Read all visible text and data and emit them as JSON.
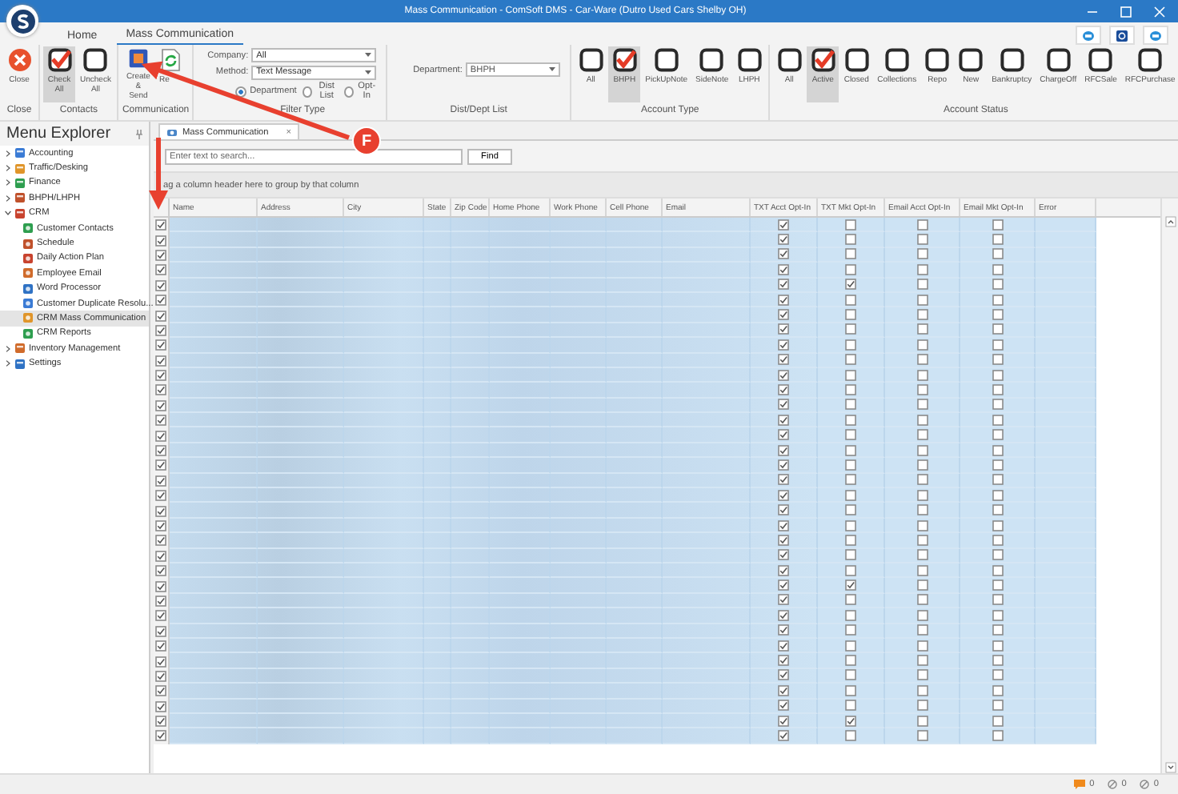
{
  "window": {
    "title": "Mass Communication - ComSoft DMS - Car-Ware (Dutro Used Cars Shelby OH)"
  },
  "ribbon_tabs": [
    {
      "label": "Home",
      "selected": false
    },
    {
      "label": "Mass Communication",
      "selected": true
    }
  ],
  "ribbon_groups": [
    {
      "label": "Close",
      "kind": "buttons",
      "items": [
        {
          "kind": "close",
          "label": "Close"
        }
      ]
    },
    {
      "label": "Contacts",
      "kind": "buttons",
      "items": [
        {
          "kind": "toggle",
          "label": "Check All",
          "checked": true
        },
        {
          "kind": "toggle",
          "label": "Uncheck All",
          "checked": false
        }
      ]
    },
    {
      "label": "Communication",
      "kind": "buttons",
      "items": [
        {
          "kind": "send",
          "label": "Create & Send"
        },
        {
          "kind": "refresh",
          "label": "Re"
        }
      ]
    },
    {
      "label": "Filter Type",
      "kind": "filter",
      "fields": [
        {
          "label": "Company:",
          "value": "All"
        },
        {
          "label": "Method:",
          "value": "Text Message"
        }
      ],
      "radios": [
        {
          "label": "Department",
          "selected": true
        },
        {
          "label": "Dist List",
          "selected": false
        },
        {
          "label": "Opt-In",
          "selected": false
        }
      ]
    },
    {
      "label": "Dist/Dept List",
      "kind": "department",
      "field": {
        "label": "Department:",
        "value": "BHPH"
      }
    },
    {
      "label": "Account Type",
      "kind": "buttons",
      "items": [
        {
          "kind": "toggle",
          "label": "All",
          "checked": false
        },
        {
          "kind": "toggle",
          "label": "BHPH",
          "checked": true
        },
        {
          "kind": "toggle",
          "label": "PickUpNote",
          "checked": false
        },
        {
          "kind": "toggle",
          "label": "SideNote",
          "checked": false
        },
        {
          "kind": "toggle",
          "label": "LHPH",
          "checked": false
        }
      ]
    },
    {
      "label": "Account Status",
      "kind": "buttons",
      "items": [
        {
          "kind": "toggle",
          "label": "All",
          "checked": false
        },
        {
          "kind": "toggle",
          "label": "Active",
          "checked": true
        },
        {
          "kind": "toggle",
          "label": "Closed",
          "checked": false
        },
        {
          "kind": "toggle",
          "label": "Collections",
          "checked": false
        },
        {
          "kind": "toggle",
          "label": "Repo",
          "checked": false
        },
        {
          "kind": "toggle",
          "label": "New",
          "checked": false
        },
        {
          "kind": "toggle",
          "label": "Bankruptcy",
          "checked": false
        },
        {
          "kind": "toggle",
          "label": "ChargeOff",
          "checked": false
        },
        {
          "kind": "toggle",
          "label": "RFCSale",
          "checked": false
        },
        {
          "kind": "toggle",
          "label": "RFCPurchase",
          "checked": false
        }
      ]
    }
  ],
  "sidebar": {
    "title": "Menu Explorer",
    "items": [
      {
        "label": "Accounting",
        "expanded": false
      },
      {
        "label": "Traffic/Desking",
        "expanded": false
      },
      {
        "label": "Finance",
        "expanded": false
      },
      {
        "label": "BHPH/LHPH",
        "expanded": false
      },
      {
        "label": "CRM",
        "expanded": true,
        "children": [
          {
            "label": "Customer Contacts",
            "selected": false
          },
          {
            "label": "Schedule",
            "selected": false
          },
          {
            "label": "Daily Action Plan",
            "selected": false
          },
          {
            "label": "Employee Email",
            "selected": false
          },
          {
            "label": "Word Processor",
            "selected": false
          },
          {
            "label": "Customer Duplicate Resolu...",
            "selected": false
          },
          {
            "label": "CRM Mass Communication",
            "selected": true
          },
          {
            "label": "CRM Reports",
            "selected": false
          }
        ]
      },
      {
        "label": "Inventory Management",
        "expanded": false
      },
      {
        "label": "Settings",
        "expanded": false
      }
    ]
  },
  "document_tab": {
    "label": "Mass Communication",
    "close": "×"
  },
  "search": {
    "placeholder": "Enter text to search...",
    "button": "Find"
  },
  "group_panel": "ag a column header here to group by that column",
  "table": {
    "columns": [
      "Name",
      "Address",
      "City",
      "State",
      "Zip Code",
      "Home Phone",
      "Work Phone",
      "Cell Phone",
      "Email",
      "TXT Acct Opt-In",
      "TXT Mkt Opt-In",
      "Email Acct Opt-In",
      "Email Mkt Opt-In",
      "Error"
    ],
    "rows": [
      {
        "checked": true,
        "txt_acct": true,
        "txt_mkt": false,
        "email_acct": false,
        "email_mkt": false
      },
      {
        "checked": true,
        "txt_acct": true,
        "txt_mkt": false,
        "email_acct": false,
        "email_mkt": false
      },
      {
        "checked": true,
        "txt_acct": true,
        "txt_mkt": false,
        "email_acct": false,
        "email_mkt": false
      },
      {
        "checked": true,
        "txt_acct": true,
        "txt_mkt": false,
        "email_acct": false,
        "email_mkt": false
      },
      {
        "checked": true,
        "txt_acct": true,
        "txt_mkt": true,
        "email_acct": false,
        "email_mkt": false
      },
      {
        "checked": true,
        "txt_acct": true,
        "txt_mkt": false,
        "email_acct": false,
        "email_mkt": false
      },
      {
        "checked": true,
        "txt_acct": true,
        "txt_mkt": false,
        "email_acct": false,
        "email_mkt": false
      },
      {
        "checked": true,
        "txt_acct": true,
        "txt_mkt": false,
        "email_acct": false,
        "email_mkt": false
      },
      {
        "checked": true,
        "txt_acct": true,
        "txt_mkt": false,
        "email_acct": false,
        "email_mkt": false
      },
      {
        "checked": true,
        "txt_acct": true,
        "txt_mkt": false,
        "email_acct": false,
        "email_mkt": false
      },
      {
        "checked": true,
        "txt_acct": true,
        "txt_mkt": false,
        "email_acct": false,
        "email_mkt": false
      },
      {
        "checked": true,
        "txt_acct": true,
        "txt_mkt": false,
        "email_acct": false,
        "email_mkt": false
      },
      {
        "checked": true,
        "txt_acct": true,
        "txt_mkt": false,
        "email_acct": false,
        "email_mkt": false
      },
      {
        "checked": true,
        "txt_acct": true,
        "txt_mkt": false,
        "email_acct": false,
        "email_mkt": false
      },
      {
        "checked": true,
        "txt_acct": true,
        "txt_mkt": false,
        "email_acct": false,
        "email_mkt": false
      },
      {
        "checked": true,
        "txt_acct": true,
        "txt_mkt": false,
        "email_acct": false,
        "email_mkt": false
      },
      {
        "checked": true,
        "txt_acct": true,
        "txt_mkt": false,
        "email_acct": false,
        "email_mkt": false
      },
      {
        "checked": true,
        "txt_acct": true,
        "txt_mkt": false,
        "email_acct": false,
        "email_mkt": false
      },
      {
        "checked": true,
        "txt_acct": true,
        "txt_mkt": false,
        "email_acct": false,
        "email_mkt": false
      },
      {
        "checked": true,
        "txt_acct": true,
        "txt_mkt": false,
        "email_acct": false,
        "email_mkt": false
      },
      {
        "checked": true,
        "txt_acct": true,
        "txt_mkt": false,
        "email_acct": false,
        "email_mkt": false
      },
      {
        "checked": true,
        "txt_acct": true,
        "txt_mkt": false,
        "email_acct": false,
        "email_mkt": false
      },
      {
        "checked": true,
        "txt_acct": true,
        "txt_mkt": false,
        "email_acct": false,
        "email_mkt": false
      },
      {
        "checked": true,
        "txt_acct": true,
        "txt_mkt": false,
        "email_acct": false,
        "email_mkt": false
      },
      {
        "checked": true,
        "txt_acct": true,
        "txt_mkt": true,
        "email_acct": false,
        "email_mkt": false
      },
      {
        "checked": true,
        "txt_acct": true,
        "txt_mkt": false,
        "email_acct": false,
        "email_mkt": false
      },
      {
        "checked": true,
        "txt_acct": true,
        "txt_mkt": false,
        "email_acct": false,
        "email_mkt": false
      },
      {
        "checked": true,
        "txt_acct": true,
        "txt_mkt": false,
        "email_acct": false,
        "email_mkt": false
      },
      {
        "checked": true,
        "txt_acct": true,
        "txt_mkt": false,
        "email_acct": false,
        "email_mkt": false
      },
      {
        "checked": true,
        "txt_acct": true,
        "txt_mkt": false,
        "email_acct": false,
        "email_mkt": false
      },
      {
        "checked": true,
        "txt_acct": true,
        "txt_mkt": false,
        "email_acct": false,
        "email_mkt": false
      },
      {
        "checked": true,
        "txt_acct": true,
        "txt_mkt": false,
        "email_acct": false,
        "email_mkt": false
      },
      {
        "checked": true,
        "txt_acct": true,
        "txt_mkt": false,
        "email_acct": false,
        "email_mkt": false
      },
      {
        "checked": true,
        "txt_acct": true,
        "txt_mkt": true,
        "email_acct": false,
        "email_mkt": false
      },
      {
        "checked": true,
        "txt_acct": true,
        "txt_mkt": false,
        "email_acct": false,
        "email_mkt": false
      }
    ]
  },
  "callout": {
    "label": "F"
  },
  "status_bar": {
    "items": [
      {
        "kind": "messages",
        "count": "0"
      },
      {
        "kind": "blocked",
        "count": "0"
      },
      {
        "kind": "blocked",
        "count": "0"
      }
    ]
  }
}
